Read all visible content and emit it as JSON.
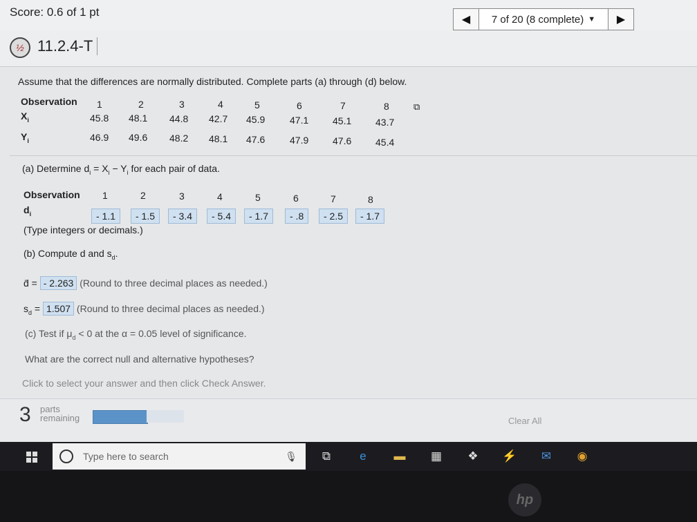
{
  "header": {
    "score": "Score: 0.6 of 1 pt",
    "counter": "7 of 20 (8 complete)",
    "question_id": "11.2.4-T"
  },
  "problem": {
    "intro": "Assume that the differences are normally distributed. Complete parts (a) through (d) below.",
    "table": {
      "row_labels": [
        "Observation",
        "X",
        "Y"
      ],
      "observations": [
        "1",
        "2",
        "3",
        "4",
        "5",
        "6",
        "7",
        "8"
      ],
      "x": [
        "45.8",
        "48.1",
        "44.8",
        "42.7",
        "45.9",
        "47.1",
        "45.1",
        "43.7"
      ],
      "y": [
        "46.9",
        "49.6",
        "48.2",
        "48.1",
        "47.6",
        "47.9",
        "47.6",
        "45.4"
      ]
    }
  },
  "part_a": {
    "prompt": "(a) Determine d",
    "prompt_rest": " = X",
    "prompt_tail": " for each pair of data.",
    "observation_label": "Observation",
    "d_label": "d",
    "observations": [
      "1",
      "2",
      "3",
      "4",
      "5",
      "6",
      "7",
      "8"
    ],
    "d_values": [
      "- 1.1",
      "- 1.5",
      "- 3.4",
      "- 5.4",
      "- 1.7",
      "- .8",
      "- 2.5",
      "- 1.7"
    ],
    "hint": "(Type integers or decimals.)"
  },
  "part_b": {
    "prompt": "(b) Compute d and s",
    "dbar_value": "- 2.263",
    "dbar_hint": "(Round to three decimal places as needed.)",
    "sd_value": "1.507",
    "sd_hint": "(Round to three decimal places as needed.)"
  },
  "part_c": {
    "prompt": "(c) Test if μ",
    "prompt_tail": " < 0 at the α = 0.05 level of significance.",
    "question": "What are the correct null and alternative hypotheses?",
    "instruction": "Click to select your answer and then click Check Answer."
  },
  "footer": {
    "parts_count": "3",
    "parts_label_1": "parts",
    "parts_label_2": "remaining",
    "clear_all": "Clear All",
    "progress": 0.6
  },
  "taskbar": {
    "search_placeholder": "Type here to search"
  },
  "colors": {
    "answer_bg": "#cfe0f0",
    "progress": "#5b93c8"
  }
}
